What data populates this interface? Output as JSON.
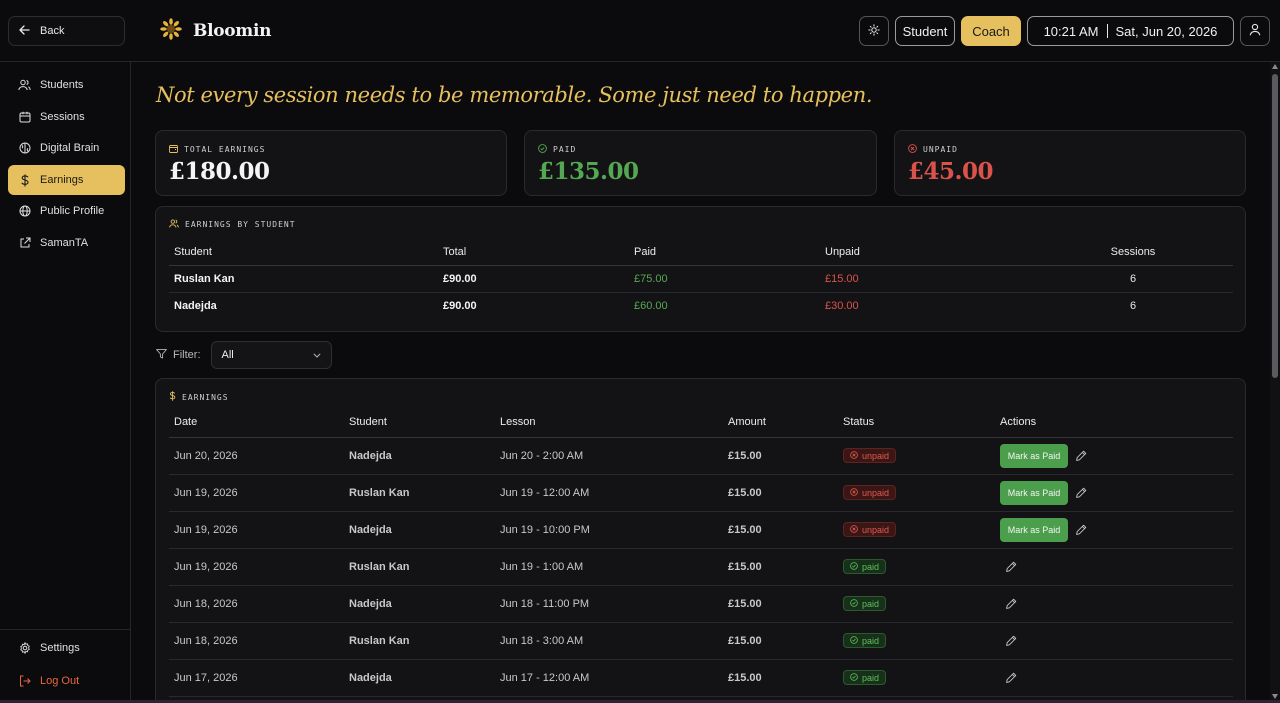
{
  "topbar": {
    "back_label": "Back",
    "app_name": "Bloomin",
    "student_label": "Student",
    "coach_label": "Coach",
    "time": "10:21 AM",
    "date": "Sat, Jun 20, 2026"
  },
  "sidebar": {
    "items": [
      {
        "label": "Students",
        "icon": "users-icon"
      },
      {
        "label": "Sessions",
        "icon": "calendar-icon"
      },
      {
        "label": "Digital Brain",
        "icon": "brain-icon"
      },
      {
        "label": "Earnings",
        "icon": "dollar-icon",
        "active": true
      },
      {
        "label": "Public Profile",
        "icon": "globe-icon"
      },
      {
        "label": "SamanTA",
        "icon": "external-link-icon"
      }
    ],
    "settings_label": "Settings",
    "logout_label": "Log Out"
  },
  "quote": "Not every session needs to be memorable. Some just need to happen.",
  "stats": {
    "total_label": "TOTAL EARNINGS",
    "total_value": "£180.00",
    "paid_label": "PAID",
    "paid_value": "£135.00",
    "unpaid_label": "UNPAID",
    "unpaid_value": "£45.00"
  },
  "by_student": {
    "title": "EARNINGS BY STUDENT",
    "headers": {
      "student": "Student",
      "total": "Total",
      "paid": "Paid",
      "unpaid": "Unpaid",
      "sessions": "Sessions"
    },
    "rows": [
      {
        "student": "Ruslan Kan",
        "total": "£90.00",
        "paid": "£75.00",
        "unpaid": "£15.00",
        "sessions": "6"
      },
      {
        "student": "Nadejda",
        "total": "£90.00",
        "paid": "£60.00",
        "unpaid": "£30.00",
        "sessions": "6"
      }
    ]
  },
  "filter": {
    "label": "Filter:",
    "value": "All"
  },
  "earnings": {
    "title": "EARNINGS",
    "headers": {
      "date": "Date",
      "student": "Student",
      "lesson": "Lesson",
      "amount": "Amount",
      "status": "Status",
      "actions": "Actions"
    },
    "mark_paid_label": "Mark as Paid",
    "rows": [
      {
        "date": "Jun 20, 2026",
        "student": "Nadejda",
        "lesson": "Jun 20 - 2:00 AM",
        "amount": "£15.00",
        "status": "unpaid"
      },
      {
        "date": "Jun 19, 2026",
        "student": "Ruslan Kan",
        "lesson": "Jun 19 - 12:00 AM",
        "amount": "£15.00",
        "status": "unpaid"
      },
      {
        "date": "Jun 19, 2026",
        "student": "Nadejda",
        "lesson": "Jun 19 - 10:00 PM",
        "amount": "£15.00",
        "status": "unpaid"
      },
      {
        "date": "Jun 19, 2026",
        "student": "Ruslan Kan",
        "lesson": "Jun 19 - 1:00 AM",
        "amount": "£15.00",
        "status": "paid"
      },
      {
        "date": "Jun 18, 2026",
        "student": "Nadejda",
        "lesson": "Jun 18 - 11:00 PM",
        "amount": "£15.00",
        "status": "paid"
      },
      {
        "date": "Jun 18, 2026",
        "student": "Ruslan Kan",
        "lesson": "Jun 18 - 3:00 AM",
        "amount": "£15.00",
        "status": "paid"
      },
      {
        "date": "Jun 17, 2026",
        "student": "Nadejda",
        "lesson": "Jun 17 - 12:00 AM",
        "amount": "£15.00",
        "status": "paid"
      }
    ]
  },
  "colors": {
    "accent": "#e6c05e",
    "paid": "#55a852",
    "unpaid": "#d9534a"
  }
}
